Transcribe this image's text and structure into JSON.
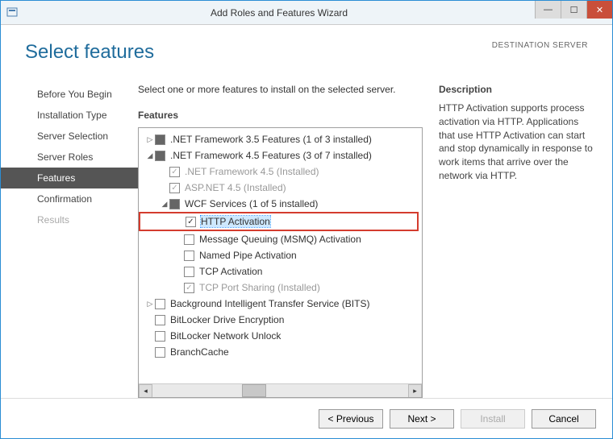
{
  "window": {
    "title": "Add Roles and Features Wizard"
  },
  "header": {
    "page_title": "Select features",
    "destination_label": "DESTINATION SERVER"
  },
  "sidebar": {
    "items": [
      {
        "label": "Before You Begin",
        "active": false,
        "disabled": false
      },
      {
        "label": "Installation Type",
        "active": false,
        "disabled": false
      },
      {
        "label": "Server Selection",
        "active": false,
        "disabled": false
      },
      {
        "label": "Server Roles",
        "active": false,
        "disabled": false
      },
      {
        "label": "Features",
        "active": true,
        "disabled": false
      },
      {
        "label": "Confirmation",
        "active": false,
        "disabled": false
      },
      {
        "label": "Results",
        "active": false,
        "disabled": true
      }
    ]
  },
  "main": {
    "instruction": "Select one or more features to install on the selected server.",
    "features_heading": "Features",
    "description_heading": "Description",
    "description_text": "HTTP Activation supports process activation via HTTP. Applications that use HTTP Activation can start and stop dynamically in response to work items that arrive over the network via HTTP."
  },
  "tree": [
    {
      "indent": 0,
      "expander": "▷",
      "check": "partial",
      "label": ".NET Framework 3.5 Features (1 of 3 installed)"
    },
    {
      "indent": 0,
      "expander": "◢",
      "check": "partial",
      "label": ".NET Framework 4.5 Features (3 of 7 installed)"
    },
    {
      "indent": 1,
      "expander": "",
      "check": "checked-disabled",
      "label": ".NET Framework 4.5 (Installed)",
      "disabled": true
    },
    {
      "indent": 1,
      "expander": "",
      "check": "checked-disabled",
      "label": "ASP.NET 4.5 (Installed)",
      "disabled": true
    },
    {
      "indent": 1,
      "expander": "◢",
      "check": "partial",
      "label": "WCF Services (1 of 5 installed)"
    },
    {
      "indent": 2,
      "expander": "",
      "check": "checked",
      "label": "HTTP Activation",
      "selected": true,
      "highlighted": true
    },
    {
      "indent": 2,
      "expander": "",
      "check": "unchecked",
      "label": "Message Queuing (MSMQ) Activation"
    },
    {
      "indent": 2,
      "expander": "",
      "check": "unchecked",
      "label": "Named Pipe Activation"
    },
    {
      "indent": 2,
      "expander": "",
      "check": "unchecked",
      "label": "TCP Activation"
    },
    {
      "indent": 2,
      "expander": "",
      "check": "checked-disabled",
      "label": "TCP Port Sharing (Installed)",
      "disabled": true
    },
    {
      "indent": 0,
      "expander": "▷",
      "check": "unchecked",
      "label": "Background Intelligent Transfer Service (BITS)"
    },
    {
      "indent": 0,
      "expander": "",
      "check": "unchecked",
      "label": "BitLocker Drive Encryption"
    },
    {
      "indent": 0,
      "expander": "",
      "check": "unchecked",
      "label": "BitLocker Network Unlock"
    },
    {
      "indent": 0,
      "expander": "",
      "check": "unchecked",
      "label": "BranchCache"
    }
  ],
  "footer": {
    "previous": "< Previous",
    "next": "Next >",
    "install": "Install",
    "cancel": "Cancel"
  }
}
